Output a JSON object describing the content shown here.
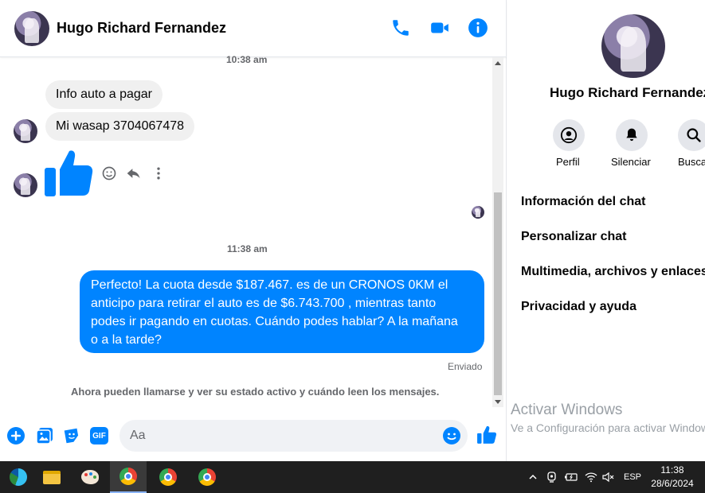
{
  "contact": {
    "name": "Hugo Richard Fernandez",
    "name_truncated": "Hugo Richard Fernandez"
  },
  "messages": {
    "timestamp_top": "10:38 am",
    "incoming": [
      {
        "text": "Info auto a pagar"
      },
      {
        "text": "Mi wasap 3704067478"
      }
    ],
    "timestamp_mid": "11:38 am",
    "outgoing": {
      "lines": [
        "Perfecto! La cuota desde $187.467. es de un CRONOS 0KM el",
        "anticipo para retirar el auto es de $6.743.700 , mientras tanto",
        "podes ir pagando en cuotas. Cuándo podes hablar? A la mañana",
        "o a la tarde?"
      ]
    },
    "status": "Enviado",
    "notice": "Ahora pueden llamarse y ver su estado activo y cuándo leen los mensajes."
  },
  "composer": {
    "placeholder": "Aa",
    "gif_label": "GIF"
  },
  "info_panel": {
    "actions": [
      {
        "label": "Perfil",
        "icon": "profile-icon"
      },
      {
        "label": "Silenciar",
        "icon": "bell-icon"
      },
      {
        "label": "Buscar",
        "icon": "search-icon"
      }
    ],
    "menu": [
      "Información del chat",
      "Personalizar chat",
      "Multimedia, archivos y enlaces",
      "Privacidad y ayuda"
    ],
    "watermark_title": "Activar Windows",
    "watermark_sub": "Ve a Configuración para activar Windows."
  },
  "taskbar": {
    "language": "ESP",
    "time": "11:38",
    "date": "28/6/2024"
  },
  "colors": {
    "accent": "#0084ff",
    "bubble_in": "#f0f0f0",
    "taskbar": "#1f1f1f"
  }
}
